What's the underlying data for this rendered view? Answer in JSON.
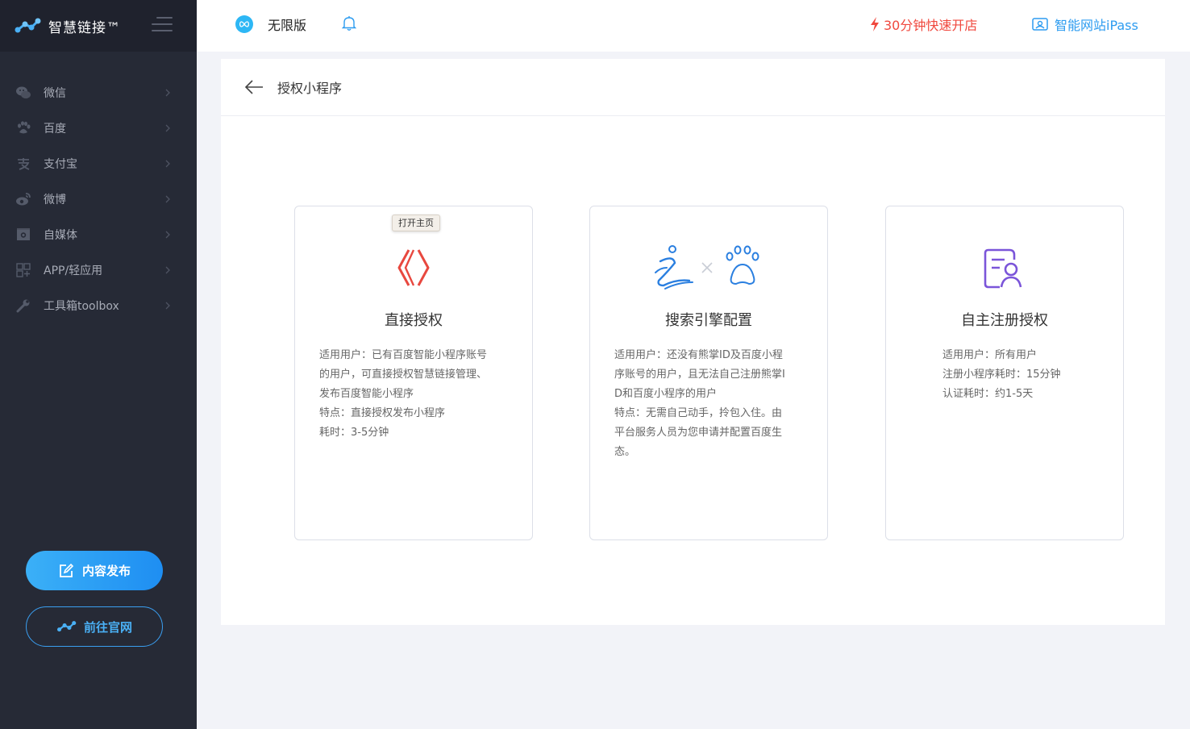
{
  "sidebar": {
    "brand": "智慧链接™",
    "items": [
      {
        "label": "微信",
        "icon": "wechat-icon"
      },
      {
        "label": "百度",
        "icon": "paw-icon"
      },
      {
        "label": "支付宝",
        "icon": "alipay-icon"
      },
      {
        "label": "微博",
        "icon": "weibo-icon"
      },
      {
        "label": "自媒体",
        "icon": "media-icon"
      },
      {
        "label": "APP/轻应用",
        "icon": "app-grid-icon"
      },
      {
        "label": "工具箱toolbox",
        "icon": "wrench-icon"
      }
    ],
    "publish_label": "内容发布",
    "site_label": "前往官网"
  },
  "header": {
    "version_label": "无限版",
    "fast_open_label": "30分钟快速开店",
    "ipass_label": "智能网站iPass"
  },
  "panel": {
    "title": "授权小程序",
    "cards": [
      {
        "title": "直接授权",
        "tooltip": "打开主页",
        "desc": [
          "适用用户：已有百度智能小程序账号",
          "的用户，可直接授权智慧链接管理、",
          "发布百度智能小程序",
          "特点：直接授权发布小程序",
          "耗时：3-5分钟"
        ]
      },
      {
        "title": "搜索引擎配置",
        "desc": [
          "适用用户：还没有熊掌ID及百度小程",
          "序账号的用户，且无法自己注册熊掌I",
          "D和百度小程序的用户",
          "特点：无需自己动手，拎包入住。由",
          "平台服务人员为您申请并配置百度生",
          "态。"
        ]
      },
      {
        "title": "自主注册授权",
        "desc": [
          "适用用户：所有用户",
          "注册小程序耗时：15分钟",
          "认证耗时：约1-5天"
        ]
      }
    ]
  },
  "colors": {
    "sidebar_bg": "#262a36",
    "accent_blue": "#2d9cf0",
    "accent_red": "#f0483e",
    "card1_icon": "#e8483f",
    "card2_icon": "#2a7fe0",
    "card3_icon": "#7b55d9"
  }
}
